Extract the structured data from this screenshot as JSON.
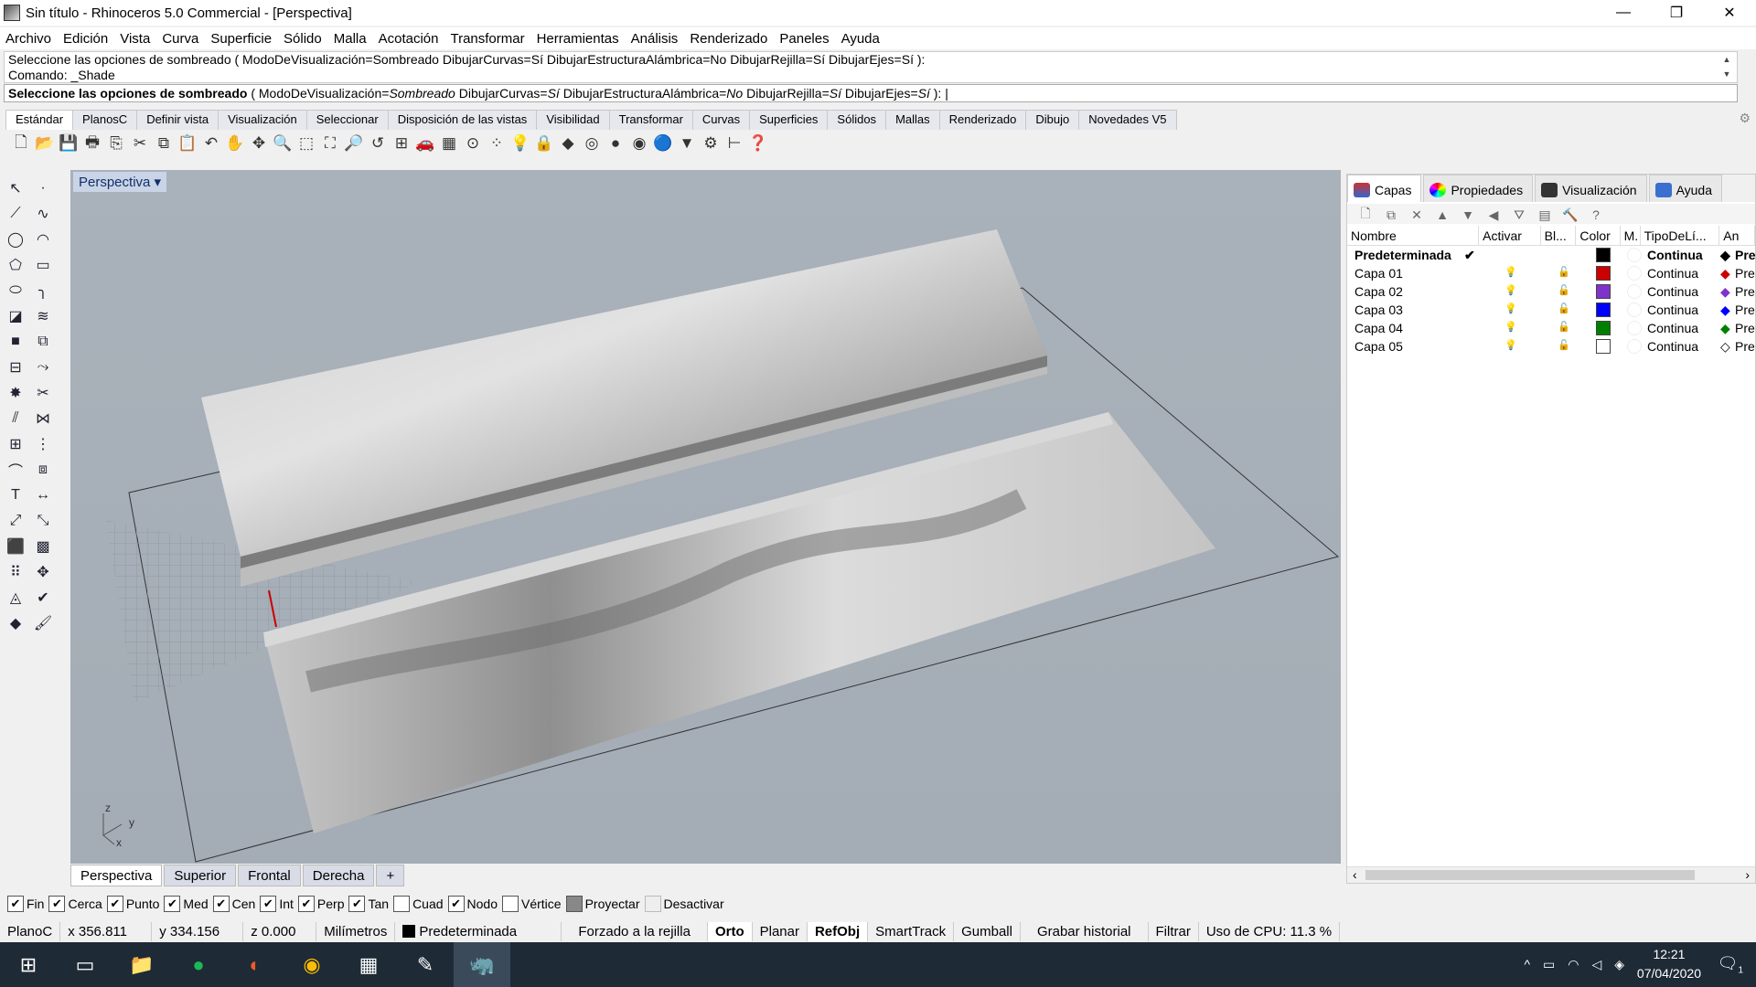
{
  "window": {
    "title": "Sin título - Rhinoceros 5.0 Commercial - [Perspectiva]",
    "minimize": "—",
    "maximize": "❐",
    "close": "✕"
  },
  "menu": [
    "Archivo",
    "Edición",
    "Vista",
    "Curva",
    "Superficie",
    "Sólido",
    "Malla",
    "Acotación",
    "Transformar",
    "Herramientas",
    "Análisis",
    "Renderizado",
    "Paneles",
    "Ayuda"
  ],
  "command": {
    "history1": "Seleccione las opciones de sombreado ( ModoDeVisualización=Sombreado  DibujarCurvas=Sí  DibujarEstructuraAlámbrica=No  DibujarRejilla=Sí  DibujarEjes=Sí ):",
    "history2": "Comando: _Shade",
    "prompt_bold": "Seleccione las opciones de sombreado",
    "prompt_open": " ( ModoDeVisualización=",
    "v1": "Sombreado",
    "o2": "  DibujarCurvas=",
    "v2": "Sí",
    "o3": "  DibujarEstructuraAlámbrica=",
    "v3": "No",
    "o4": "  DibujarRejilla=",
    "v4": "Sí",
    "o5": "  DibujarEjes=",
    "v5": "Sí",
    "prompt_close": " ):"
  },
  "toolbar_tabs": [
    "Estándar",
    "PlanosC",
    "Definir vista",
    "Visualización",
    "Seleccionar",
    "Disposición de las vistas",
    "Visibilidad",
    "Transformar",
    "Curvas",
    "Superficies",
    "Sólidos",
    "Mallas",
    "Renderizado",
    "Dibujo",
    "Novedades V5"
  ],
  "toolbar_icons": [
    [
      "new-file-icon",
      "🗋"
    ],
    [
      "open-icon",
      "📂"
    ],
    [
      "save-icon",
      "💾"
    ],
    [
      "print-icon",
      "🖶"
    ],
    [
      "export-icon",
      "⎘"
    ],
    [
      "cut-icon",
      "✂"
    ],
    [
      "copy-icon",
      "⧉"
    ],
    [
      "paste-icon",
      "📋"
    ],
    [
      "undo-icon",
      "↶"
    ],
    [
      "pan-icon",
      "✋"
    ],
    [
      "rotate-view-icon",
      "✥"
    ],
    [
      "zoom-icon",
      "🔍"
    ],
    [
      "zoom-window-icon",
      "⬚"
    ],
    [
      "zoom-extents-icon",
      "⛶"
    ],
    [
      "zoom-selected-icon",
      "🔎"
    ],
    [
      "undo-view-icon",
      "↺"
    ],
    [
      "four-viewports-icon",
      "⊞"
    ],
    [
      "car-icon",
      "🚗"
    ],
    [
      "grid-icon",
      "▦"
    ],
    [
      "circle-pt-icon",
      "⊙"
    ],
    [
      "points-icon",
      "⁘"
    ],
    [
      "light-icon",
      "💡"
    ],
    [
      "lock-icon",
      "🔒"
    ],
    [
      "layers-icon",
      "◆"
    ],
    [
      "color-wheel-icon",
      "◎"
    ],
    [
      "shade-icon",
      "●"
    ],
    [
      "render-icon",
      "◉"
    ],
    [
      "sphere-icon",
      "🔵"
    ],
    [
      "filter-icon",
      "▼"
    ],
    [
      "settings-icon",
      "⚙"
    ],
    [
      "dim-icon",
      "⊢"
    ],
    [
      "help-icon",
      "❓"
    ]
  ],
  "left_tools": [
    "pointer-icon",
    "point-icon",
    "polyline-icon",
    "curve-icon",
    "circle-icon",
    "arc-icon",
    "polygon-icon",
    "rectangle-icon",
    "ellipse-icon",
    "fillet-icon",
    "surface-icon",
    "loft-icon",
    "box-icon",
    "boolean-icon",
    "extrude-icon",
    "sweep-icon",
    "explode-icon",
    "trim-icon",
    "split-icon",
    "join-icon",
    "group-icon",
    "array-icon",
    "blend-icon",
    "offset-icon",
    "text-icon",
    "dimension-icon",
    "transform-icon",
    "scale-icon",
    "cube-icon",
    "mesh-icon",
    "grid-array-icon",
    "gumball-icon",
    "analyze-icon",
    "check-icon",
    "render-icon",
    "paint-icon"
  ],
  "viewport": {
    "label": "Perspectiva",
    "axis_z": "z",
    "axis_y": "y",
    "axis_x": "x"
  },
  "viewport_tabs": [
    "Perspectiva",
    "Superior",
    "Frontal",
    "Derecha",
    "+"
  ],
  "panel": {
    "tabs": [
      "Capas",
      "Propiedades",
      "Visualización",
      "Ayuda"
    ],
    "columns": [
      "Nombre",
      "Activar",
      "Bl...",
      "Color",
      "M.",
      "TipoDeLí...",
      "An"
    ],
    "layers": [
      {
        "name": "Predeterminada",
        "current": "✔",
        "color": "#000000",
        "linetype": "Continua",
        "print": "Pre",
        "bold": true
      },
      {
        "name": "Capa 01",
        "color": "#cc0000",
        "linetype": "Continua",
        "print": "Pre"
      },
      {
        "name": "Capa 02",
        "color": "#7f33cc",
        "linetype": "Continua",
        "print": "Pre"
      },
      {
        "name": "Capa 03",
        "color": "#0000ff",
        "linetype": "Continua",
        "print": "Pre"
      },
      {
        "name": "Capa 04",
        "color": "#008000",
        "linetype": "Continua",
        "print": "Pre"
      },
      {
        "name": "Capa 05",
        "color": "#ffffff",
        "linetype": "Continua",
        "print": "Pre"
      }
    ]
  },
  "osnaps": [
    {
      "label": "Fin",
      "on": true
    },
    {
      "label": "Cerca",
      "on": true
    },
    {
      "label": "Punto",
      "on": true
    },
    {
      "label": "Med",
      "on": true
    },
    {
      "label": "Cen",
      "on": true
    },
    {
      "label": "Int",
      "on": true
    },
    {
      "label": "Perp",
      "on": true
    },
    {
      "label": "Tan",
      "on": true
    },
    {
      "label": "Cuad",
      "on": false
    },
    {
      "label": "Nodo",
      "on": true
    },
    {
      "label": "Vértice",
      "on": false
    },
    {
      "label": "Proyectar",
      "on": false
    },
    {
      "label": "Desactivar",
      "on": false
    }
  ],
  "status": {
    "cplane": "PlanoC",
    "x": "x 356.811",
    "y": "y 334.156",
    "z": "z 0.000",
    "units": "Milímetros",
    "layer": "Predeterminada",
    "grid_snap": "Forzado a la rejilla",
    "ortho": "Orto",
    "planar": "Planar",
    "osnap": "RefObj",
    "smarttrack": "SmartTrack",
    "gumball": "Gumball",
    "history": "Grabar historial",
    "filter": "Filtrar",
    "cpu": "Uso de CPU: 11.3 %"
  },
  "taskbar": {
    "time": "12:21",
    "date": "07/04/2020",
    "notifications": "1"
  }
}
